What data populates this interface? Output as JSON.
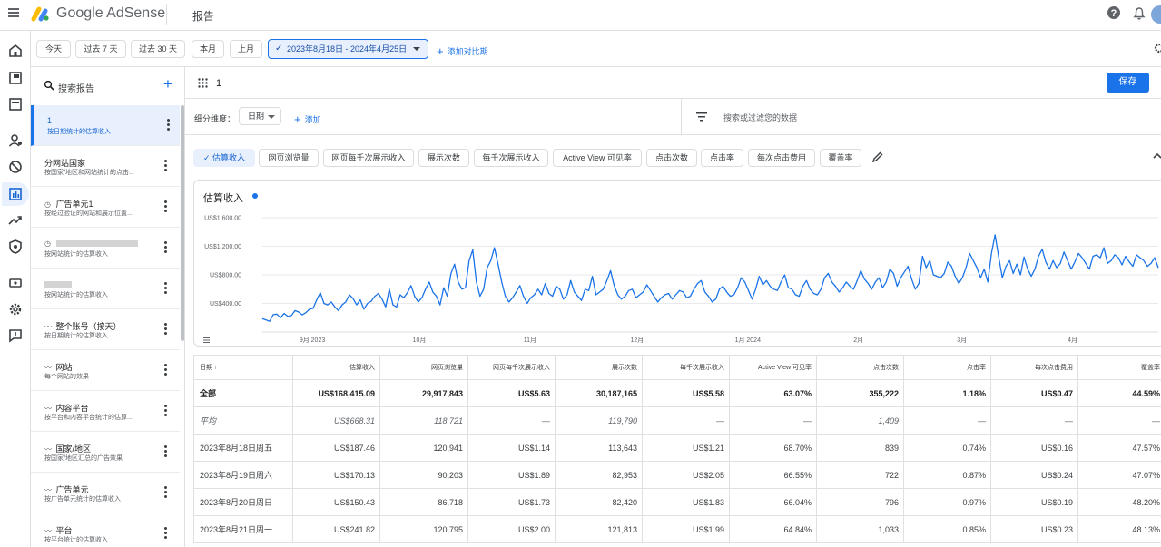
{
  "header": {
    "brand": "Google AdSense",
    "page": "报告",
    "help": "?"
  },
  "rail": {
    "icons": [
      "home-icon",
      "ads-icon",
      "sites-icon",
      "users-icon",
      "block-icon",
      "reports-icon",
      "trend-icon",
      "policy-icon",
      "payments-icon",
      "settings-icon",
      "feedback-icon"
    ]
  },
  "toolbar": {
    "today": "今天",
    "last7": "过去 7 天",
    "last30": "过去 30 天",
    "this_month": "本月",
    "last_month": "上月",
    "date_range": "2023年8月18日 - 2024年4月25日",
    "add_compare": "添加对比期"
  },
  "saved": {
    "search_placeholder": "搜索报告",
    "items": [
      {
        "title": "1",
        "subtitle": "按日期统计的估算收入"
      },
      {
        "title": "分网站国家",
        "subtitle": "按国家/地区和网站统计的点击..."
      },
      {
        "title": "广告单元1",
        "subtitle": "按经过验证的网站和展示位置..."
      },
      {
        "title": "",
        "subtitle": "按网站统计的估算收入"
      },
      {
        "title": "",
        "subtitle": "按网站统计的估算收入"
      },
      {
        "title": "整个账号（按天）",
        "subtitle": "按日期统计的估算收入"
      },
      {
        "title": "网站",
        "subtitle": "每个网站的效果"
      },
      {
        "title": "内容平台",
        "subtitle": "按平台和内容平台统计的估算..."
      },
      {
        "title": "国家/地区",
        "subtitle": "按国家/地区汇总的广告效果"
      },
      {
        "title": "广告单元",
        "subtitle": "按广告单元统计的估算收入"
      },
      {
        "title": "平台",
        "subtitle": "按平台统计的估算收入"
      }
    ]
  },
  "report": {
    "title": "1",
    "save": "保存"
  },
  "dimension": {
    "label": "细分维度：",
    "value": "日期",
    "add": "添加",
    "filter_placeholder": "搜索或过滤您的数据"
  },
  "metrics": [
    "估算收入",
    "网页浏览量",
    "网页每千次展示收入",
    "展示次数",
    "每千次展示收入",
    "Active View 可见率",
    "点击次数",
    "点击率",
    "每次点击费用",
    "覆盖率"
  ],
  "chart": {
    "metric_label": "估算收入",
    "line_color": "#1a73e8"
  },
  "chart_data": {
    "type": "line",
    "title": "估算收入",
    "x_range": [
      "2023-08-18",
      "2024-04-25"
    ],
    "x_tick_labels": [
      "9月 2023",
      "10月",
      "11月",
      "12月",
      "1月 2024",
      "2月",
      "3月",
      "4月"
    ],
    "y_tick_labels": [
      "US$1,600.00",
      "US$1,200.00",
      "US$800.00",
      "US$400.00"
    ],
    "ylim": [
      0,
      1600
    ],
    "grid": true,
    "series": [
      {
        "name": "估算收入",
        "values": [
          187,
          170,
          150,
          242,
          250,
          200,
          260,
          220,
          230,
          300,
          280,
          240,
          270,
          320,
          330,
          450,
          550,
          400,
          380,
          420,
          350,
          300,
          380,
          420,
          520,
          470,
          380,
          450,
          320,
          400,
          430,
          500,
          540,
          460,
          350,
          600,
          380,
          350,
          520,
          480,
          550,
          650,
          500,
          420,
          480,
          600,
          700,
          560,
          500,
          380,
          620,
          500,
          820,
          950,
          700,
          600,
          620,
          1000,
          1150,
          700,
          500,
          600,
          900,
          1000,
          1180,
          950,
          700,
          500,
          420,
          480,
          560,
          650,
          500,
          400,
          480,
          520,
          600,
          520,
          680,
          540,
          500,
          640,
          600,
          460,
          520,
          720,
          560,
          500,
          440,
          600,
          580,
          780,
          520,
          560,
          600,
          720,
          860,
          650,
          520,
          460,
          500,
          580,
          600,
          480,
          520,
          560,
          660,
          580,
          500,
          420,
          480,
          520,
          540,
          460,
          520,
          580,
          560,
          480,
          500,
          600,
          680,
          720,
          560,
          500,
          420,
          460,
          600,
          640,
          560,
          500,
          520,
          620,
          760,
          700,
          580,
          460,
          600,
          780,
          660,
          720,
          640,
          600,
          580,
          700,
          800,
          620,
          600,
          520,
          500,
          640,
          720,
          600,
          540,
          520,
          600,
          760,
          820,
          700,
          640,
          560,
          620,
          700,
          640,
          600,
          720,
          860,
          740,
          680,
          600,
          700,
          760,
          620,
          700,
          880,
          820,
          640,
          760,
          840,
          920,
          740,
          600,
          680,
          1060,
          900,
          1000,
          800,
          780,
          760,
          820,
          980,
          920,
          780,
          680,
          760,
          900,
          1100,
          1000,
          900,
          760,
          880,
          700,
          1100,
          1360,
          1050,
          760,
          920,
          1000,
          820,
          950,
          800,
          1050,
          880,
          780,
          880,
          1060,
          1160,
          980,
          880,
          1000,
          900,
          960,
          1120,
          1000,
          880,
          980,
          1100,
          1040,
          960,
          880,
          1060,
          1080,
          1040,
          1180,
          960,
          1000,
          1080,
          1040,
          940,
          1060,
          980,
          920,
          1080,
          1040,
          1000,
          920,
          960,
          1040,
          900
        ]
      }
    ]
  },
  "table": {
    "columns": [
      "日期 ↑",
      "估算收入",
      "网页浏览量",
      "网页每千次展示收入",
      "展示次数",
      "每千次展示收入",
      "Active View 可见率",
      "点击次数",
      "点击率",
      "每次点击费用",
      "覆盖率"
    ],
    "rows": [
      {
        "cls": "total",
        "cells": [
          "全部",
          "US$168,415.09",
          "29,917,843",
          "US$5.63",
          "30,187,165",
          "US$5.58",
          "63.07%",
          "355,222",
          "1.18%",
          "US$0.47",
          "44.59%"
        ]
      },
      {
        "cls": "avg",
        "cells": [
          "平均",
          "US$668.31",
          "118,721",
          "—",
          "119,790",
          "—",
          "—",
          "1,409",
          "—",
          "—",
          "—"
        ]
      },
      {
        "cls": "",
        "cells": [
          "2023年8月18日周五",
          "US$187.46",
          "120,941",
          "US$1.14",
          "113,643",
          "US$1.21",
          "68.70%",
          "839",
          "0.74%",
          "US$0.16",
          "47.57%"
        ]
      },
      {
        "cls": "",
        "cells": [
          "2023年8月19日周六",
          "US$170.13",
          "90,203",
          "US$1.89",
          "82,953",
          "US$2.05",
          "66.55%",
          "722",
          "0.87%",
          "US$0.24",
          "47.07%"
        ]
      },
      {
        "cls": "",
        "cells": [
          "2023年8月20日周日",
          "US$150.43",
          "86,718",
          "US$1.73",
          "82,420",
          "US$1.83",
          "66.04%",
          "796",
          "0.97%",
          "US$0.19",
          "48.20%"
        ]
      },
      {
        "cls": "",
        "cells": [
          "2023年8月21日周一",
          "US$241.82",
          "120,795",
          "US$2.00",
          "121,813",
          "US$1.99",
          "64.84%",
          "1,033",
          "0.85%",
          "US$0.23",
          "48.13%"
        ]
      }
    ]
  }
}
